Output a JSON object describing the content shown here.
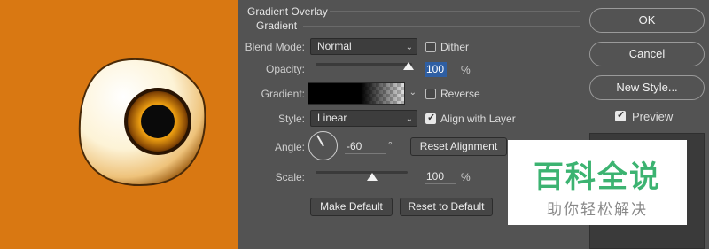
{
  "dialog": {
    "title": "Gradient Overlay",
    "section": "Gradient",
    "blend_mode": {
      "label": "Blend Mode:",
      "value": "Normal"
    },
    "dither": {
      "label": "Dither",
      "checked": false
    },
    "opacity": {
      "label": "Opacity:",
      "value": "100",
      "unit": "%",
      "level": 1.0
    },
    "gradient": {
      "label": "Gradient:"
    },
    "reverse": {
      "label": "Reverse",
      "checked": false
    },
    "style": {
      "label": "Style:",
      "value": "Linear"
    },
    "align_with_layer": {
      "label": "Align with Layer",
      "checked": true
    },
    "angle": {
      "label": "Angle:",
      "value": "-60",
      "unit": "°"
    },
    "reset_alignment": "Reset Alignment",
    "scale": {
      "label": "Scale:",
      "value": "100",
      "unit": "%",
      "level": 0.5
    },
    "make_default": "Make Default",
    "reset_to_default": "Reset to Default"
  },
  "actions": {
    "ok": "OK",
    "cancel": "Cancel",
    "new_style": "New Style...",
    "preview": {
      "label": "Preview",
      "checked": true
    }
  },
  "watermark": {
    "main": "百科全说",
    "sub": "助你轻松解决"
  },
  "colors": {
    "canvas_bg": "#d97812",
    "panel_bg": "#535353",
    "watermark_green": "#3cb371"
  }
}
